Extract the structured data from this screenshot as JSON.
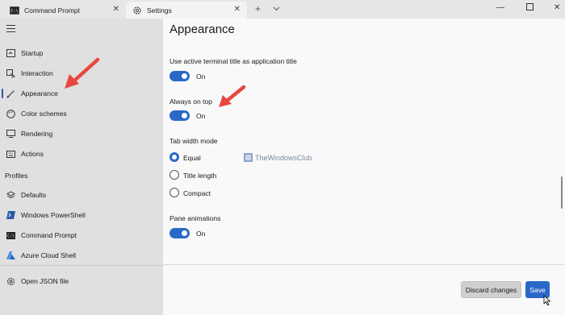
{
  "tabs": [
    {
      "label": "Command Prompt",
      "icon": "cmd-icon"
    },
    {
      "label": "Settings",
      "icon": "gear-icon"
    }
  ],
  "sidebar": {
    "items": [
      {
        "label": "Startup",
        "icon": "startup-icon"
      },
      {
        "label": "Interaction",
        "icon": "interaction-icon"
      },
      {
        "label": "Appearance",
        "icon": "brush-icon"
      },
      {
        "label": "Color schemes",
        "icon": "palette-icon"
      },
      {
        "label": "Rendering",
        "icon": "monitor-icon"
      },
      {
        "label": "Actions",
        "icon": "keyboard-icon"
      }
    ],
    "profiles_heading": "Profiles",
    "profiles": [
      {
        "label": "Defaults",
        "icon": "layers-icon"
      },
      {
        "label": "Windows PowerShell",
        "icon": "powershell-icon"
      },
      {
        "label": "Command Prompt",
        "icon": "cmd-icon"
      },
      {
        "label": "Azure Cloud Shell",
        "icon": "azure-icon"
      }
    ],
    "open_json": "Open JSON file",
    "selected": "Appearance"
  },
  "main": {
    "title": "Appearance",
    "use_title_label": "Use active terminal title as application title",
    "use_title_state": "On",
    "always_on_top_label": "Always on top",
    "always_on_top_state": "On",
    "tab_width_label": "Tab width mode",
    "tab_width_options": [
      "Equal",
      "Title length",
      "Compact"
    ],
    "tab_width_selected": "Equal",
    "pane_anim_label": "Pane animations",
    "pane_anim_state": "On",
    "watermark": "TheWindowsClub"
  },
  "footer": {
    "discard_label": "Discard changes",
    "save_label": "Save"
  },
  "colors": {
    "accent": "#2a68c8",
    "annotation_arrow": "#e8473f",
    "sidebar_bg": "#e0e0e0"
  }
}
